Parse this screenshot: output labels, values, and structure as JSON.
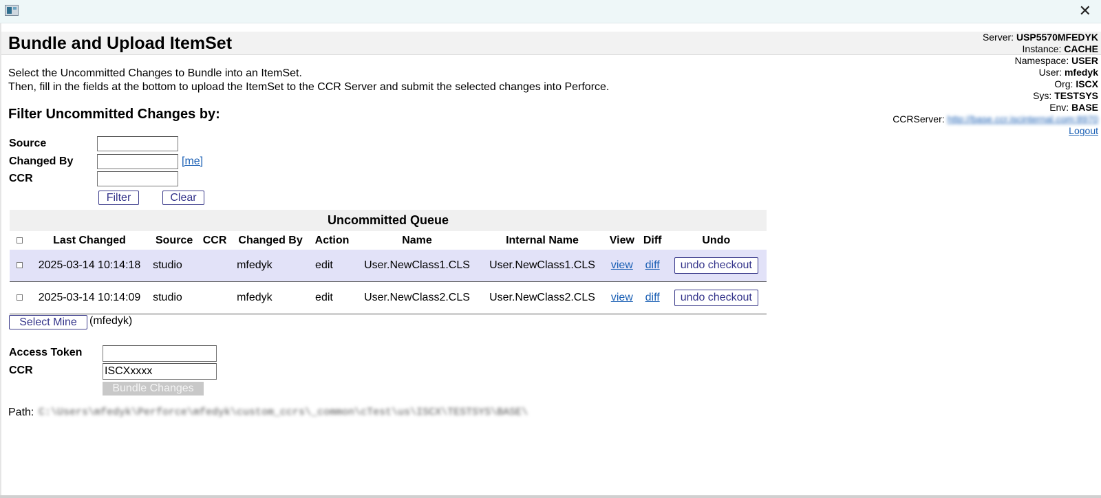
{
  "window": {
    "close_label": "✕"
  },
  "header": {
    "title": "Bundle and Upload ItemSet",
    "server_info": [
      {
        "label": "Server: ",
        "value": "USP5570MFEDYK"
      },
      {
        "label": "Instance: ",
        "value": "CACHE"
      },
      {
        "label": "Namespace: ",
        "value": "USER"
      },
      {
        "label": "User: ",
        "value": "mfedyk"
      },
      {
        "label": "Org: ",
        "value": "ISCX"
      },
      {
        "label": "Sys: ",
        "value": "TESTSYS"
      },
      {
        "label": "Env: ",
        "value": "BASE"
      }
    ],
    "ccr_server_label": "CCRServer: ",
    "ccr_server_url": "http://base.ccr.iscinternal.com:8970",
    "logout_label": "Logout"
  },
  "instructions": {
    "line1": "Select the Uncommitted Changes to Bundle into an ItemSet.",
    "line2": "Then, fill in the fields at the bottom to upload the ItemSet to the CCR Server and submit the selected changes into Perforce."
  },
  "filter": {
    "heading": "Filter Uncommitted Changes by:",
    "source_label": "Source",
    "source_value": "",
    "changed_by_label": "Changed By",
    "changed_by_value": "",
    "me_link": "[me]",
    "ccr_label": "CCR",
    "ccr_value": "",
    "filter_button": "Filter",
    "clear_button": "Clear"
  },
  "queue": {
    "caption": "Uncommitted Queue",
    "columns": [
      "Last Changed",
      "Source",
      "CCR",
      "Changed By",
      "Action",
      "Name",
      "Internal Name",
      "View",
      "Diff",
      "Undo"
    ],
    "rows": [
      {
        "last_changed": "2025-03-14 10:14:18",
        "source": "studio",
        "ccr": "",
        "changed_by": "mfedyk",
        "action": "edit",
        "name": "User.NewClass1.CLS",
        "internal_name": "User.NewClass1.CLS",
        "view": "view",
        "diff": "diff",
        "undo": "undo checkout"
      },
      {
        "last_changed": "2025-03-14 10:14:09",
        "source": "studio",
        "ccr": "",
        "changed_by": "mfedyk",
        "action": "edit",
        "name": "User.NewClass2.CLS",
        "internal_name": "User.NewClass2.CLS",
        "view": "view",
        "diff": "diff",
        "undo": "undo checkout"
      }
    ]
  },
  "select_mine": {
    "button": "Select Mine",
    "note": "(mfedyk)"
  },
  "bundle": {
    "access_token_label": "Access Token",
    "access_token_value": "",
    "ccr_label": "CCR",
    "ccr_value": "ISCXxxxx",
    "bundle_button": "Bundle Changes"
  },
  "path": {
    "label": "Path:",
    "value": "C:\\Users\\mfedyk\\Perforce\\mfedyk\\custom_ccrs\\_common\\cTest\\us\\ISCX\\TESTSYS\\BASE\\"
  }
}
